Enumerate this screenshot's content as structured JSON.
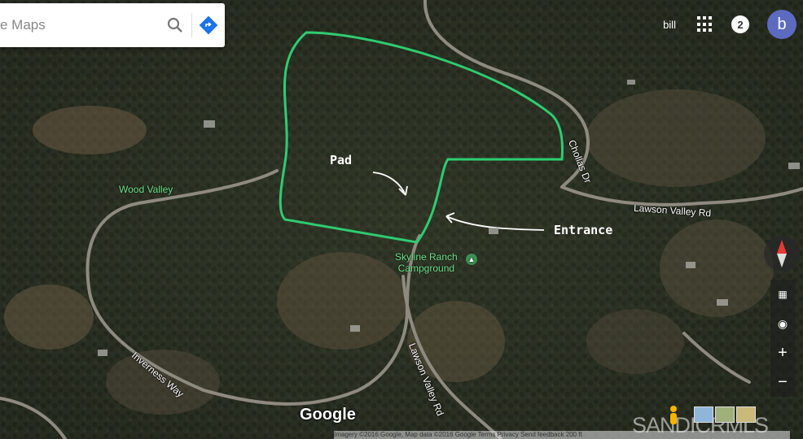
{
  "search": {
    "query": "e Maps"
  },
  "header": {
    "user_name": "bill",
    "notification_count": "2",
    "avatar_letter": "b"
  },
  "annotations": {
    "pad": "Pad",
    "entrance": "Entrance",
    "parcel_outline_color": "#2ecc71",
    "arrow_color": "#ffffff"
  },
  "map": {
    "roads": {
      "chollas": "Chollas Dr",
      "lawson_upper": "Lawson Valley Rd",
      "lawson_lower": "Lawson Valley Rd",
      "inverness": "Inverness Way"
    },
    "places": {
      "wood_valley": "Wood Valley",
      "campground": "Skyline Ranch\nCampground"
    },
    "zoom_in": "+",
    "zoom_out": "−",
    "google_logo": "Google",
    "attribution": "Imagery ©2016 Google, Map data ©2016 Google    Terms    Privacy    Send feedback    200 ft",
    "watermark": "SANDICRMLS"
  }
}
